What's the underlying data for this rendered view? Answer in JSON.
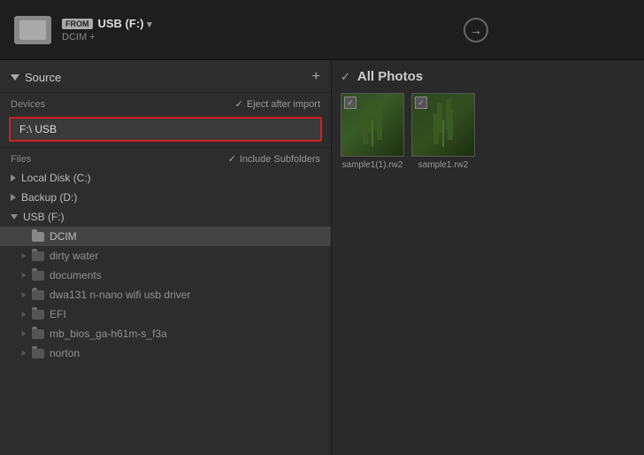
{
  "header": {
    "from_badge": "FROM",
    "source": "USB (F:)",
    "source_suffix": "▾",
    "sub_label": "DCIM +",
    "arrow_icon": "→"
  },
  "left_panel": {
    "title": "Source",
    "add_button": "+",
    "devices_label": "Devices",
    "eject_label": "Eject after import",
    "selected_device": "F:\\ USB",
    "files_label": "Files",
    "include_subfolders_label": "Include Subfolders",
    "tree": [
      {
        "id": "local-disk",
        "label": "Local Disk (C:)",
        "indent": 0,
        "type": "collapsed"
      },
      {
        "id": "backup",
        "label": "Backup (D:)",
        "indent": 0,
        "type": "collapsed"
      },
      {
        "id": "usb",
        "label": "USB (F:)",
        "indent": 0,
        "type": "expanded"
      },
      {
        "id": "dcim",
        "label": "DCIM",
        "indent": 1,
        "type": "folder",
        "active": true
      },
      {
        "id": "dirty-water",
        "label": "dirty water",
        "indent": 1,
        "type": "folder-small"
      },
      {
        "id": "documents",
        "label": "documents",
        "indent": 1,
        "type": "folder-small"
      },
      {
        "id": "dwa131",
        "label": "dwa131 n-nano wifi usb driver",
        "indent": 1,
        "type": "folder-small"
      },
      {
        "id": "efi",
        "label": "EFI",
        "indent": 1,
        "type": "folder-small"
      },
      {
        "id": "mb-bios",
        "label": "mb_bios_ga-h61m-s_f3a",
        "indent": 1,
        "type": "folder-small"
      },
      {
        "id": "norton",
        "label": "norton",
        "indent": 1,
        "type": "folder-small"
      }
    ]
  },
  "right_panel": {
    "all_photos_label": "All Photos",
    "thumbnails": [
      {
        "id": "thumb1",
        "label": "sample1(1).rw2"
      },
      {
        "id": "thumb2",
        "label": "sample1.rw2"
      }
    ]
  }
}
